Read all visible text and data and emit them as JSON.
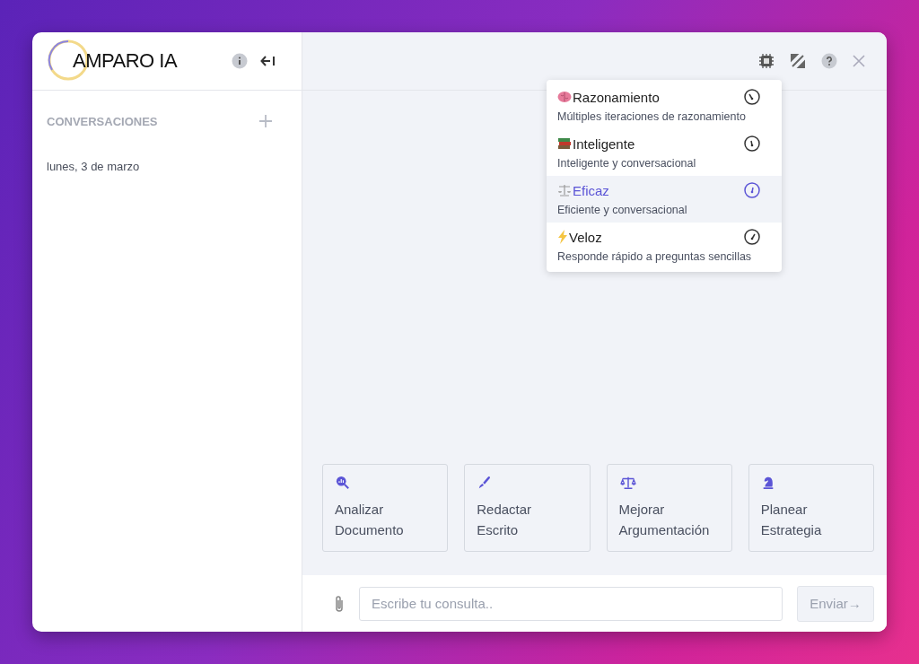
{
  "brand": {
    "name": "AMPARO IA"
  },
  "sidebar": {
    "heading": "CONVERSACIONES",
    "groups": [
      {
        "date": "lunes, 3 de marzo"
      }
    ]
  },
  "model_menu": [
    {
      "kind": "brain",
      "name": "Razonamiento",
      "description": "Múltiples iteraciones de razonamiento",
      "selected": false
    },
    {
      "kind": "books",
      "name": "Inteligente",
      "description": "Inteligente y conversacional",
      "selected": false
    },
    {
      "kind": "scales",
      "name": "Eficaz",
      "description": "Eficiente y conversacional",
      "selected": true
    },
    {
      "kind": "bolt",
      "name": "Veloz",
      "description": "Responde rápido a preguntas sencillas",
      "selected": false
    }
  ],
  "suggestions": [
    {
      "kind": "analyze",
      "lines": [
        "Analizar",
        "Documento"
      ]
    },
    {
      "kind": "pen",
      "lines": [
        "Redactar",
        "Escrito"
      ]
    },
    {
      "kind": "scales",
      "lines": [
        "Mejorar",
        "Argumentación"
      ]
    },
    {
      "kind": "chess",
      "lines": [
        "Planear",
        "Estrategia"
      ]
    }
  ],
  "composer": {
    "placeholder": "Escribe tu consulta..",
    "send": "Enviar→",
    "send_disabled": true
  }
}
